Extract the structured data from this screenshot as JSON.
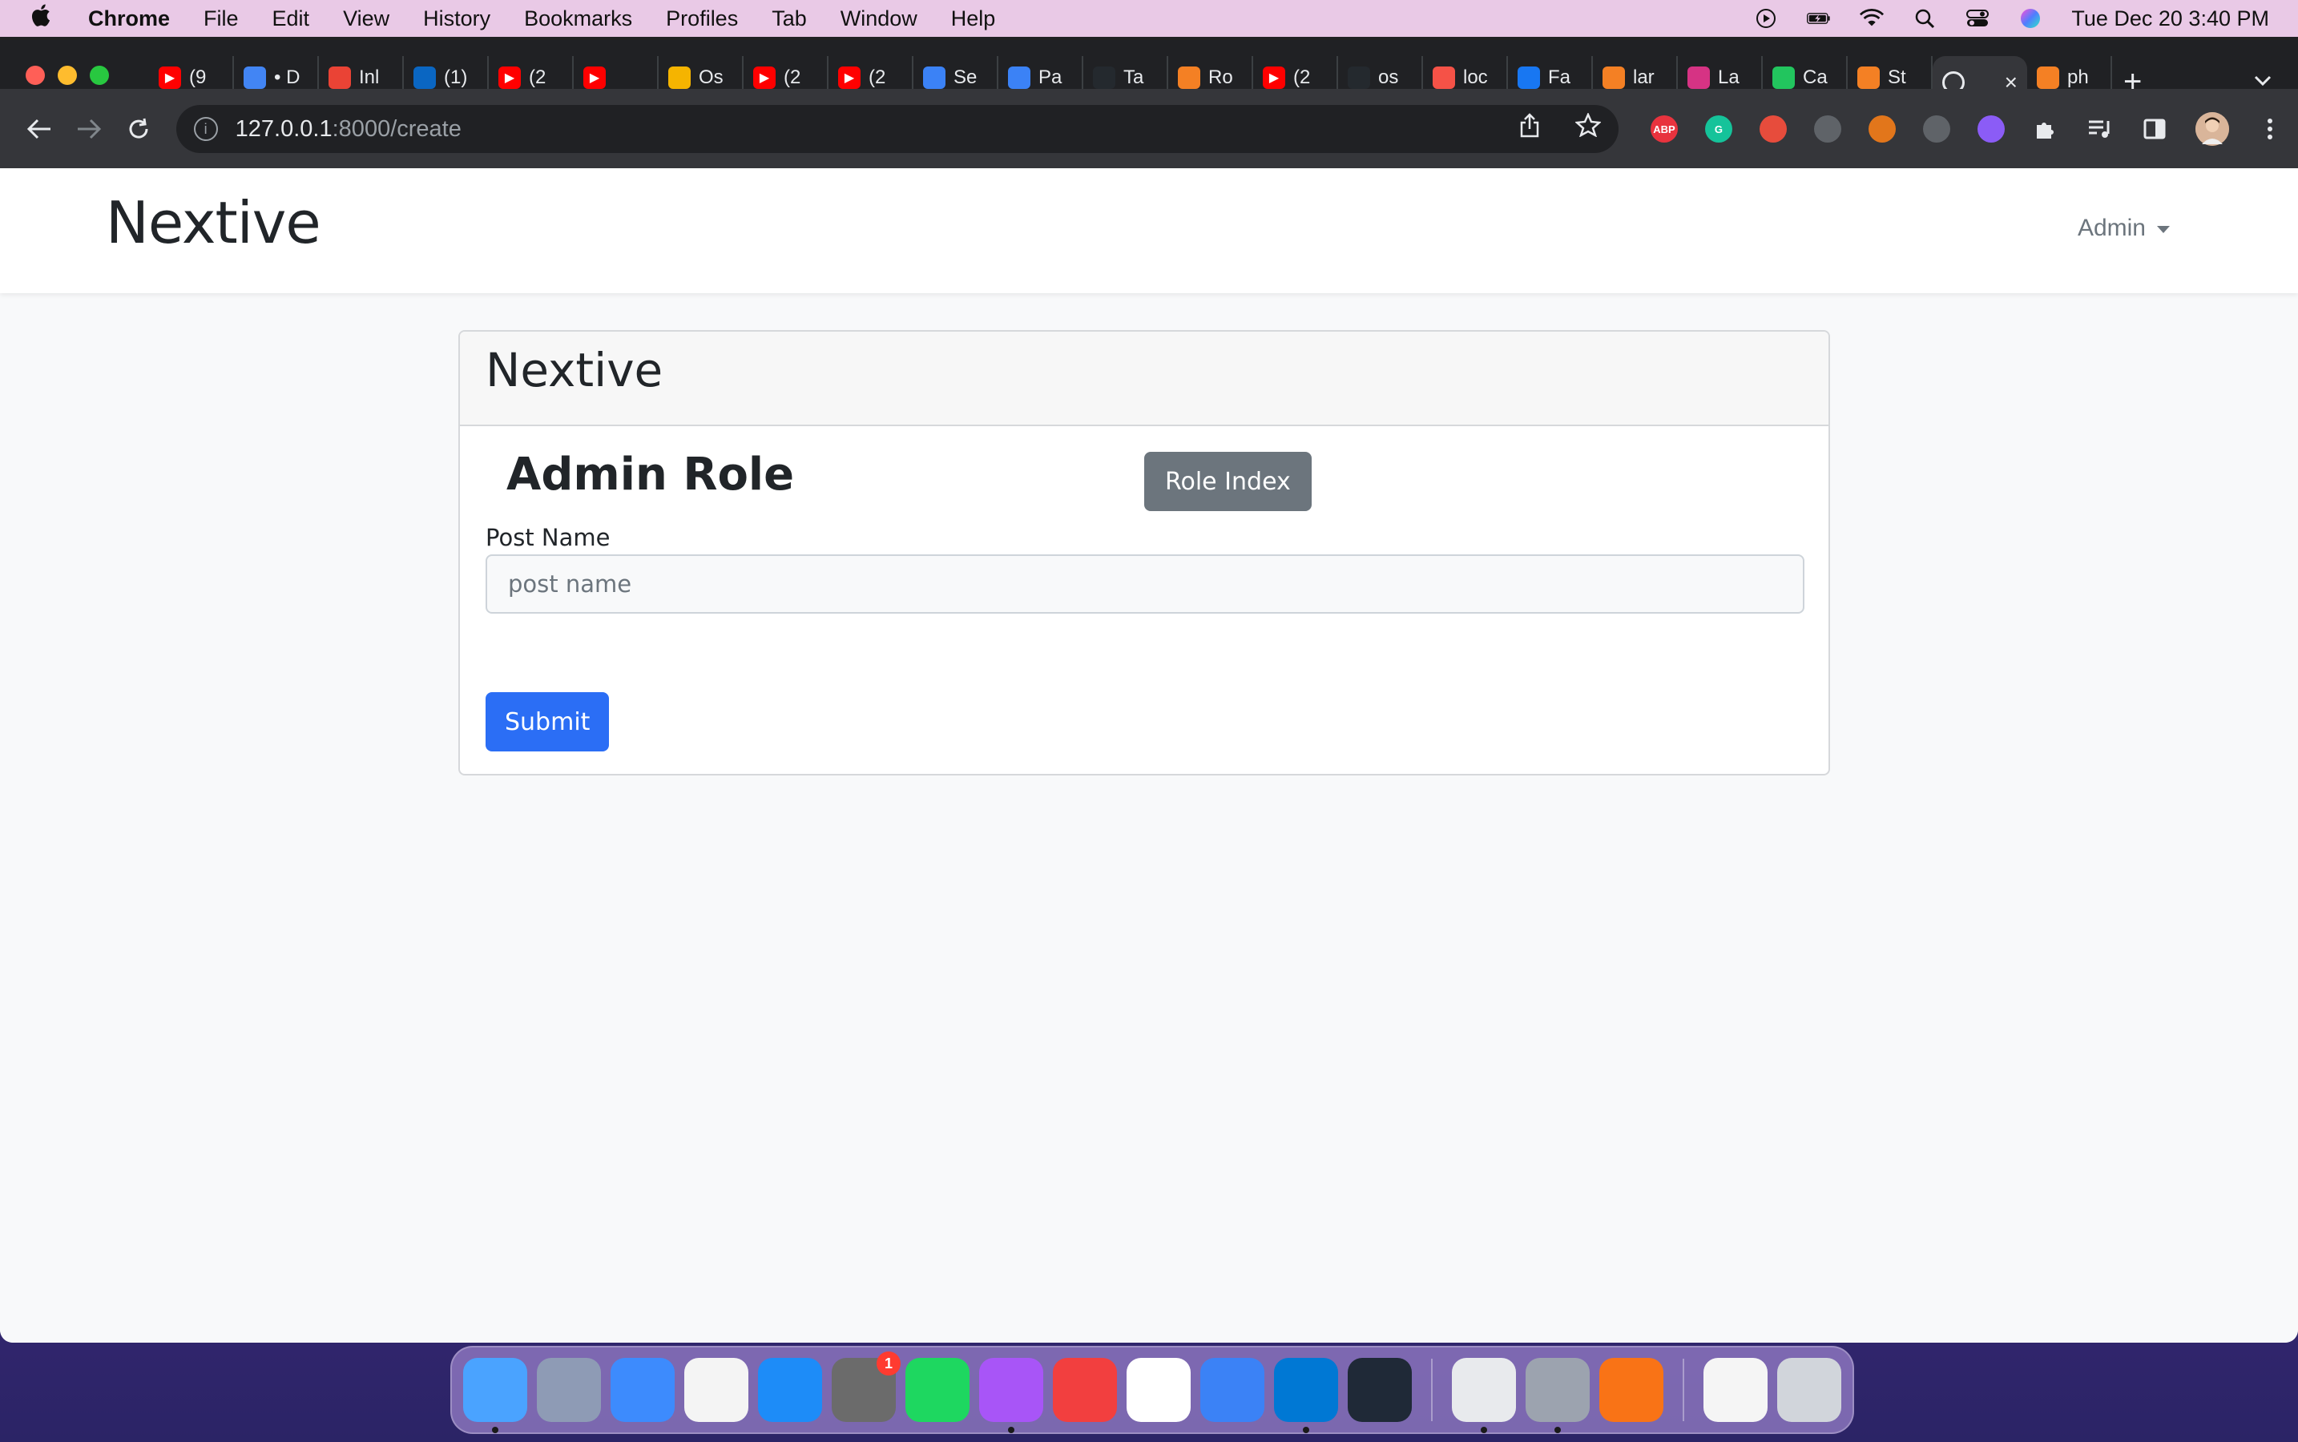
{
  "menubar": {
    "app_name": "Chrome",
    "items": [
      "File",
      "Edit",
      "View",
      "History",
      "Bookmarks",
      "Profiles",
      "Tab",
      "Window",
      "Help"
    ],
    "clock": "Tue Dec 20  3:40 PM"
  },
  "tabs": [
    {
      "icon": "youtube-icon",
      "label": "(9",
      "color": "#ff0000"
    },
    {
      "icon": "gmail-icon",
      "label": "• D",
      "color": "#4285f4"
    },
    {
      "icon": "gmail-icon",
      "label": "Inl",
      "color": "#ea4335"
    },
    {
      "icon": "linkedin-icon",
      "label": "(1)",
      "color": "#0a66c2"
    },
    {
      "icon": "youtube-icon",
      "label": "(2",
      "color": "#ff0000"
    },
    {
      "icon": "youtube-icon",
      "label": "",
      "color": "#ff0000"
    },
    {
      "icon": "os-icon",
      "label": "Os",
      "color": "#f5b400"
    },
    {
      "icon": "youtube-icon",
      "label": "(2",
      "color": "#ff0000"
    },
    {
      "icon": "youtube-icon",
      "label": "(2",
      "color": "#ff0000"
    },
    {
      "icon": "bookmark-icon",
      "label": "Se",
      "color": "#3b82f6"
    },
    {
      "icon": "bookmark-icon",
      "label": "Pa",
      "color": "#3b82f6"
    },
    {
      "icon": "github-icon",
      "label": "Ta",
      "color": "#24292e"
    },
    {
      "icon": "stackoverflow-icon",
      "label": "Ro",
      "color": "#f48024"
    },
    {
      "icon": "youtube-icon",
      "label": "(2",
      "color": "#ff0000"
    },
    {
      "icon": "github-icon",
      "label": "os",
      "color": "#24292e"
    },
    {
      "icon": "laravel-icon",
      "label": "loc",
      "color": "#f55247"
    },
    {
      "icon": "facebook-icon",
      "label": "Fa",
      "color": "#1877f2"
    },
    {
      "icon": "stackoverflow-icon",
      "label": "lar",
      "color": "#f48024"
    },
    {
      "icon": "app-icon",
      "label": "La",
      "color": "#d63384"
    },
    {
      "icon": "refresh-icon",
      "label": "Ca",
      "color": "#22c55e"
    },
    {
      "icon": "stackoverflow-icon",
      "label": "St",
      "color": "#f48024"
    },
    {
      "icon": "globe-icon",
      "label": "",
      "color": "#e8eaed",
      "active": true
    },
    {
      "icon": "stackoverflow-icon",
      "label": "ph",
      "color": "#f48024"
    }
  ],
  "address_bar": {
    "host": "127.0.0.1",
    "path": ":8000/create"
  },
  "extensions": [
    {
      "name": "abp-icon",
      "label": "ABP",
      "color": "#e8333e"
    },
    {
      "name": "grammarly-icon",
      "label": "G",
      "color": "#15c39a"
    },
    {
      "name": "ext-icon",
      "label": "",
      "color": "#e74c3c"
    },
    {
      "name": "cloud-icon",
      "label": "",
      "color": "#5f6368"
    },
    {
      "name": "metamask-icon",
      "label": "",
      "color": "#e2761b"
    },
    {
      "name": "mail-icon",
      "label": "",
      "color": "#5f6368"
    },
    {
      "name": "puzzle-icon",
      "label": "",
      "color": "#8b5cf6"
    }
  ],
  "navbar": {
    "brand": "Nextive",
    "user_menu": "Admin"
  },
  "card": {
    "header": "Nextive",
    "title": "Admin Role",
    "index_button": "Role Index",
    "field_label": "Post Name",
    "field_placeholder": "post name",
    "submit_button": "Submit"
  },
  "dock": {
    "apps": [
      {
        "name": "finder-icon",
        "color": "#4aa3ff",
        "running": true
      },
      {
        "name": "launchpad-icon",
        "color": "#8e9bb5",
        "running": false
      },
      {
        "name": "mail-icon",
        "color": "#3d8bfd",
        "running": false
      },
      {
        "name": "photos-icon",
        "color": "#f4f4f4",
        "running": false
      },
      {
        "name": "app-store-icon",
        "color": "#1d8cf8",
        "running": false
      },
      {
        "name": "system-preferences-icon",
        "color": "#6b6b6b",
        "running": false,
        "badge": "1"
      },
      {
        "name": "spotify-icon",
        "color": "#1ed760",
        "running": false
      },
      {
        "name": "messenger-icon",
        "color": "#a855f7",
        "running": true
      },
      {
        "name": "wps-office-icon",
        "color": "#f23f3f",
        "running": false
      },
      {
        "name": "ai-app-icon",
        "color": "#ffffff",
        "running": false
      },
      {
        "name": "xcode-icon",
        "color": "#3b82f6",
        "running": false
      },
      {
        "name": "vscode-icon",
        "color": "#0078d4",
        "running": true
      },
      {
        "name": "activity-monitor-icon",
        "color": "#1f2937",
        "running": false
      },
      {
        "name": "chrome-icon",
        "color": "#e8eaed",
        "running": true
      },
      {
        "name": "settings-icon",
        "color": "#9ca3af",
        "running": true
      },
      {
        "name": "pencil-app-icon",
        "color": "#f97316",
        "running": false
      },
      {
        "name": "contacts-icon",
        "color": "#f5f5f5",
        "running": false
      },
      {
        "name": "trash-icon",
        "color": "#d1d5db",
        "running": false
      }
    ]
  }
}
